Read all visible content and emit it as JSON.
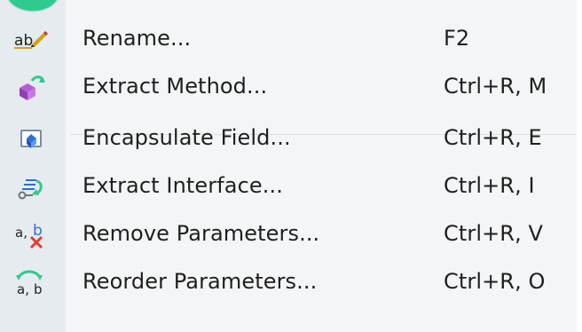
{
  "menu": {
    "items": [
      {
        "label": "Rename...",
        "shortcut": "F2",
        "icon": "rename-icon"
      },
      {
        "label": "Extract Method...",
        "shortcut": "Ctrl+R, M",
        "icon": "extract-method-icon"
      },
      {
        "label": "Encapsulate Field...",
        "shortcut": "Ctrl+R, E",
        "icon": "encapsulate-field-icon"
      },
      {
        "label": "Extract Interface...",
        "shortcut": "Ctrl+R, I",
        "icon": "extract-interface-icon"
      },
      {
        "label": "Remove Parameters...",
        "shortcut": "Ctrl+R, V",
        "icon": "remove-parameters-icon"
      },
      {
        "label": "Reorder Parameters...",
        "shortcut": "Ctrl+R, O",
        "icon": "reorder-parameters-icon"
      }
    ],
    "icon_texts": {
      "rename": "ab",
      "remove_a": "a,",
      "remove_b": "b",
      "reorder": "a, b"
    }
  },
  "colors": {
    "gutter": "#e6ebf0",
    "menu_background": "#f4f5f7",
    "text": "#1f1f1f",
    "accent_green": "#2fca8d",
    "accent_red": "#e33b2f",
    "accent_blue": "#2f6fd6"
  }
}
